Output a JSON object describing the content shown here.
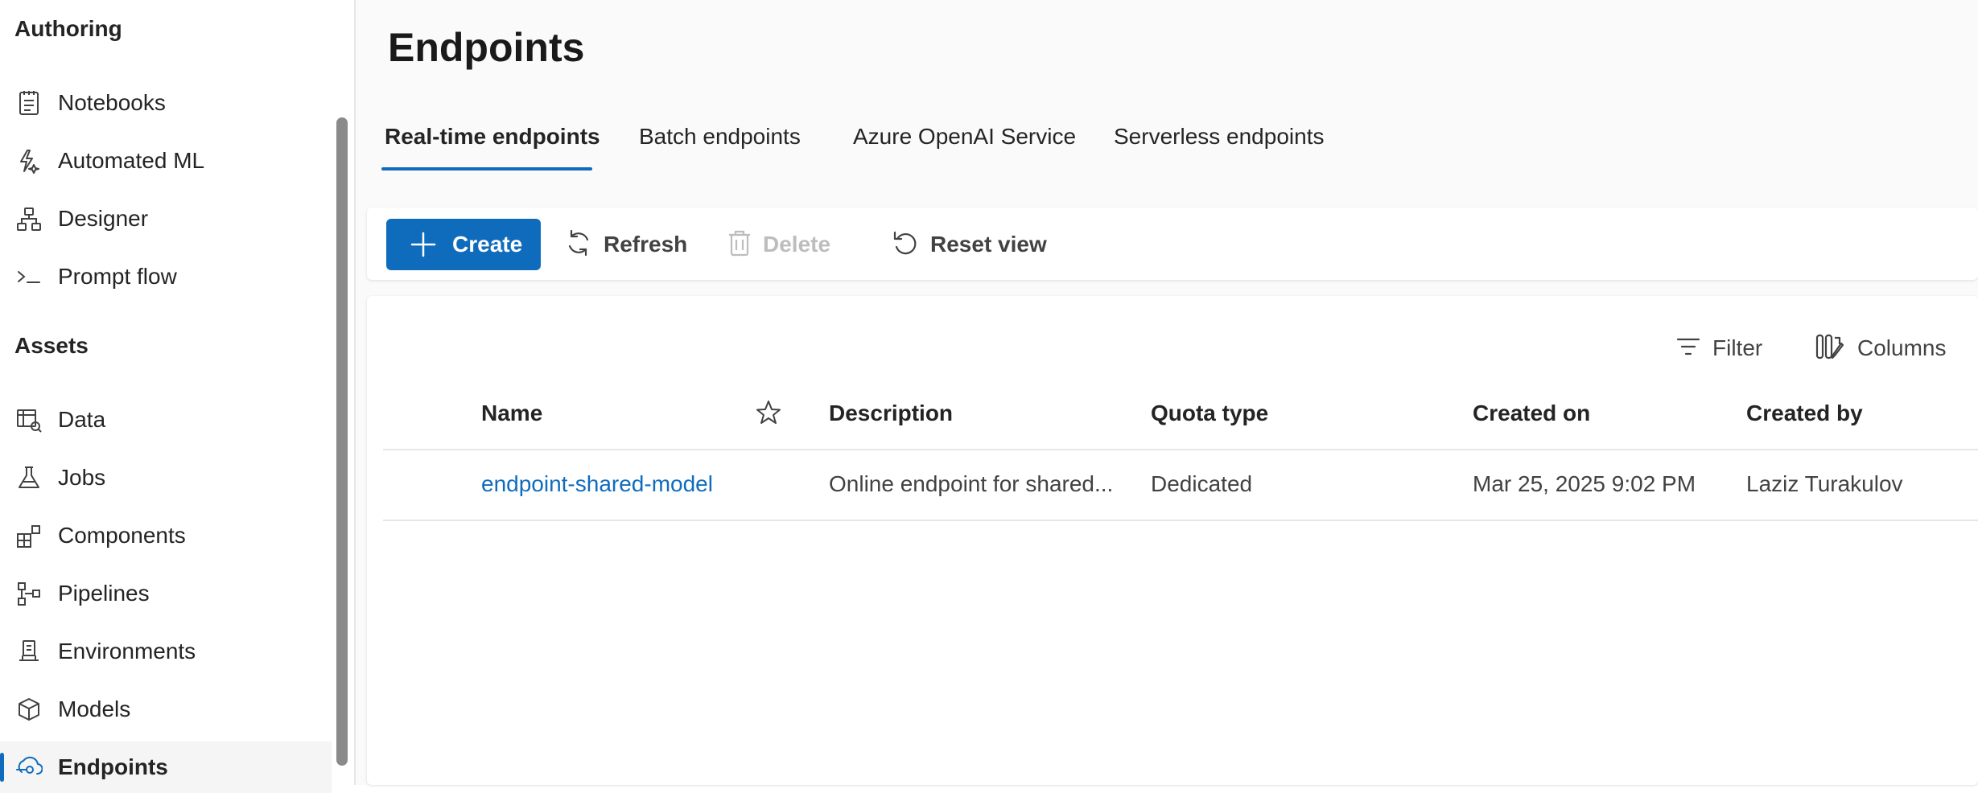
{
  "sidebar": {
    "authoring_header": "Authoring",
    "authoring_items": [
      {
        "label": "Notebooks",
        "icon": "notebook-icon"
      },
      {
        "label": "Automated ML",
        "icon": "automated-ml-icon"
      },
      {
        "label": "Designer",
        "icon": "designer-icon"
      },
      {
        "label": "Prompt flow",
        "icon": "prompt-flow-icon"
      }
    ],
    "assets_header": "Assets",
    "assets_items": [
      {
        "label": "Data",
        "icon": "data-icon"
      },
      {
        "label": "Jobs",
        "icon": "flask-icon"
      },
      {
        "label": "Components",
        "icon": "components-icon"
      },
      {
        "label": "Pipelines",
        "icon": "pipelines-icon"
      },
      {
        "label": "Environments",
        "icon": "environments-icon"
      },
      {
        "label": "Models",
        "icon": "cube-icon"
      },
      {
        "label": "Endpoints",
        "icon": "endpoints-icon",
        "active": true
      }
    ]
  },
  "page": {
    "title": "Endpoints"
  },
  "tabs": [
    {
      "label": "Real-time endpoints",
      "active": true
    },
    {
      "label": "Batch endpoints"
    },
    {
      "label": "Azure OpenAI Service"
    },
    {
      "label": "Serverless endpoints"
    }
  ],
  "toolbar": {
    "create": "Create",
    "refresh": "Refresh",
    "delete": "Delete",
    "reset_view": "Reset view"
  },
  "grid": {
    "filter": "Filter",
    "columns": "Columns",
    "headers": {
      "name": "Name",
      "description": "Description",
      "quota_type": "Quota type",
      "created_on": "Created on",
      "created_by": "Created by"
    },
    "rows": [
      {
        "name": "endpoint-shared-model",
        "description": "Online endpoint for shared...",
        "quota_type": "Dedicated",
        "created_on": "Mar 25, 2025 9:02 PM",
        "created_by": "Laziz Turakulov"
      }
    ]
  },
  "colors": {
    "accent": "#0f6cbd",
    "disabled": "#bdbdbd"
  }
}
